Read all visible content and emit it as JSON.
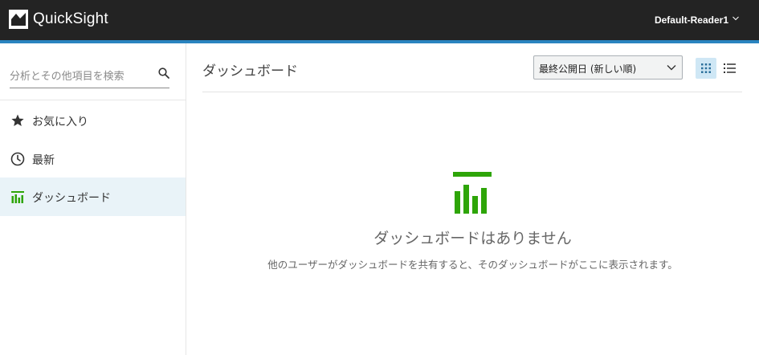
{
  "app": {
    "brand": "QuickSight",
    "user": "Default-Reader1"
  },
  "sidebar": {
    "search_placeholder": "分析とその他項目を検索",
    "items": [
      {
        "label": "お気に入り",
        "icon": "star-icon",
        "active": false
      },
      {
        "label": "最新",
        "icon": "clock-icon",
        "active": false
      },
      {
        "label": "ダッシュボード",
        "icon": "dashboard-icon",
        "active": true
      }
    ]
  },
  "main": {
    "title": "ダッシュボード",
    "sort": {
      "selected": "最終公開日 (新しい順)"
    },
    "view": {
      "active": "grid"
    },
    "empty_state": {
      "title": "ダッシュボードはありません",
      "message": "他のユーザーがダッシュボードを共有すると、そのダッシュボードがここに表示されます。"
    }
  },
  "colors": {
    "topbar": "#232323",
    "accent_bar": "#2a84c0",
    "brand_green": "#2ea508",
    "active_nav_bg": "#e9f3f8",
    "active_view_bg": "#cfe7f5"
  }
}
